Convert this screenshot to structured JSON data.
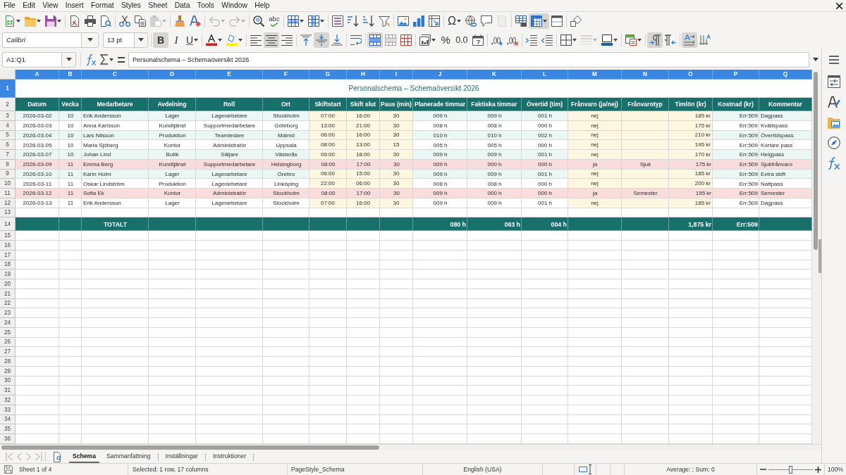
{
  "menu_bar": [
    "File",
    "Edit",
    "View",
    "Insert",
    "Format",
    "Styles",
    "Sheet",
    "Data",
    "Tools",
    "Window",
    "Help"
  ],
  "standard_toolbar": [
    [
      {
        "kind": "new",
        "pressed": false,
        "disabled": false
      },
      {
        "kind": "open",
        "pressed": false,
        "disabled": false
      },
      {
        "kind": "save",
        "pressed": false,
        "disabled": false
      }
    ],
    [
      {
        "kind": "pdf",
        "pressed": false,
        "disabled": false
      },
      {
        "kind": "print",
        "pressed": false,
        "disabled": false
      },
      {
        "kind": "preview",
        "pressed": false,
        "disabled": false
      }
    ],
    [
      {
        "kind": "cut",
        "pressed": false,
        "disabled": false
      },
      {
        "kind": "copy",
        "pressed": false,
        "disabled": false
      },
      {
        "kind": "paste",
        "pressed": false,
        "disabled": true
      }
    ],
    [
      {
        "kind": "clone",
        "pressed": false,
        "disabled": false
      },
      {
        "kind": "clear",
        "pressed": false,
        "disabled": false
      }
    ],
    [
      {
        "kind": "undo",
        "pressed": false,
        "disabled": true
      },
      {
        "kind": "redo",
        "pressed": false,
        "disabled": true
      }
    ],
    [
      {
        "kind": "find",
        "pressed": false,
        "disabled": false
      },
      {
        "kind": "spelling",
        "label": "abc",
        "pressed": false,
        "disabled": false
      }
    ],
    [
      {
        "kind": "row",
        "pressed": false,
        "disabled": false
      },
      {
        "kind": "column",
        "pressed": false,
        "disabled": false
      }
    ],
    [
      {
        "kind": "sort",
        "pressed": false,
        "disabled": false
      },
      {
        "kind": "ascending",
        "pressed": false,
        "disabled": false
      },
      {
        "kind": "descending",
        "pressed": false,
        "disabled": false
      },
      {
        "kind": "filter",
        "pressed": false,
        "disabled": false
      }
    ],
    [
      {
        "kind": "image",
        "pressed": false,
        "disabled": false
      },
      {
        "kind": "chart",
        "pressed": false,
        "disabled": false
      },
      {
        "kind": "pivot",
        "pressed": false,
        "disabled": false
      }
    ],
    [
      {
        "kind": "special",
        "label": "Ω",
        "pressed": false,
        "disabled": false
      },
      {
        "kind": "hyperlink",
        "pressed": false,
        "disabled": false
      },
      {
        "kind": "comment",
        "pressed": false,
        "disabled": false
      },
      {
        "kind": "headerfooter",
        "pressed": false,
        "disabled": true
      }
    ],
    [
      {
        "kind": "printarea",
        "pressed": false,
        "disabled": false
      },
      {
        "kind": "freeze",
        "pressed": true,
        "disabled": false
      },
      {
        "kind": "split",
        "pressed": false,
        "disabled": false
      }
    ],
    [
      {
        "kind": "draw",
        "pressed": false,
        "disabled": false
      }
    ]
  ],
  "formatting_toolbar": {
    "font_name": "Calibri",
    "font_size": "13 pt",
    "groups": [
      [
        {
          "kind": "bold",
          "label": "B",
          "pressed": true,
          "disabled": false
        },
        {
          "kind": "italic",
          "label": "I",
          "pressed": false,
          "disabled": false
        },
        {
          "kind": "underline",
          "label": "U",
          "pressed": false,
          "disabled": false
        }
      ],
      [
        {
          "kind": "fontcolor",
          "pressed": false,
          "disabled": false
        },
        {
          "kind": "highlight",
          "pressed": false,
          "disabled": false
        }
      ],
      [
        {
          "kind": "alignleft",
          "pressed": false,
          "disabled": false
        },
        {
          "kind": "aligncenter",
          "pressed": true,
          "disabled": false
        },
        {
          "kind": "alignright",
          "pressed": false,
          "disabled": false
        }
      ],
      [
        {
          "kind": "aligntop",
          "pressed": false,
          "disabled": false
        },
        {
          "kind": "alignmiddle",
          "pressed": true,
          "disabled": false
        },
        {
          "kind": "alignbottom",
          "pressed": false,
          "disabled": false
        }
      ],
      [
        {
          "kind": "wrap",
          "pressed": false,
          "disabled": false
        }
      ],
      [
        {
          "kind": "mergecenter",
          "pressed": true,
          "disabled": false
        },
        {
          "kind": "merge",
          "pressed": false,
          "disabled": false
        },
        {
          "kind": "unmerge",
          "pressed": false,
          "disabled": false
        }
      ],
      [
        {
          "kind": "currency",
          "pressed": false,
          "disabled": false
        },
        {
          "kind": "percent",
          "label": "%",
          "pressed": false,
          "disabled": false
        },
        {
          "kind": "number",
          "label": "0.0",
          "pressed": false,
          "disabled": false
        },
        {
          "kind": "date",
          "pressed": false,
          "disabled": false
        }
      ],
      [
        {
          "kind": "adddecimal",
          "pressed": false,
          "disabled": false
        },
        {
          "kind": "deletedecimal",
          "pressed": false,
          "disabled": false
        }
      ],
      [
        {
          "kind": "indent",
          "pressed": false,
          "disabled": false
        },
        {
          "kind": "outdent",
          "pressed": false,
          "disabled": false
        }
      ],
      [
        {
          "kind": "borders",
          "pressed": false,
          "disabled": false
        },
        {
          "kind": "borderstyle",
          "pressed": false,
          "disabled": true
        },
        {
          "kind": "bordercolor",
          "pressed": false,
          "disabled": false
        }
      ],
      [
        {
          "kind": "conditional",
          "pressed": false,
          "disabled": false
        }
      ],
      [
        {
          "kind": "ltr",
          "pressed": true,
          "disabled": false
        },
        {
          "kind": "rtl",
          "pressed": false,
          "disabled": false
        }
      ],
      [
        {
          "kind": "textltr",
          "pressed": true,
          "disabled": false
        },
        {
          "kind": "texttb",
          "pressed": false,
          "disabled": false
        }
      ]
    ]
  },
  "formula_bar": {
    "name_box": "A1:Q1",
    "formula": "Personalschema – Schemaöversikt 2026"
  },
  "sheet": {
    "columns": [
      {
        "label": "A",
        "selected": true
      },
      {
        "label": "B",
        "selected": true
      },
      {
        "label": "C",
        "selected": true
      },
      {
        "label": "D",
        "selected": true
      },
      {
        "label": "E",
        "selected": true
      },
      {
        "label": "F",
        "selected": true
      },
      {
        "label": "G",
        "selected": true
      },
      {
        "label": "H",
        "selected": true
      },
      {
        "label": "I",
        "selected": true
      },
      {
        "label": "J",
        "selected": true
      },
      {
        "label": "K",
        "selected": true
      },
      {
        "label": "L",
        "selected": true
      },
      {
        "label": "M",
        "selected": true
      },
      {
        "label": "N",
        "selected": true
      },
      {
        "label": "O",
        "selected": true
      },
      {
        "label": "P",
        "selected": true
      },
      {
        "label": "Q",
        "selected": true
      }
    ],
    "rows": [
      {
        "number": "1",
        "selected": true,
        "kind": "title",
        "title": "Personalschema – Schemaöversikt 2026"
      },
      {
        "number": "2",
        "selected": false,
        "kind": "header",
        "headings": [
          "Datum",
          "Vecka",
          "Medarbetare",
          "Avdelning",
          "Roll",
          "Ort",
          "Skiftstart",
          "Skift slut",
          "Paus (min)",
          "Planerade timmar",
          "Faktiska timmar",
          "Övertid (tim)",
          "Frånvaro (ja/nej)",
          "Frånvarotyp",
          "Timlön (kr)",
          "Kostnad (kr)",
          "Kommentar"
        ]
      },
      {
        "number": "3",
        "selected": false,
        "kind": "data",
        "color": "#eaf7f5",
        "highlighted": false,
        "date": "2026-03-02",
        "week": "10",
        "employee": "Erik Andersson",
        "department": "Lager",
        "role": "Lagerarbetare",
        "city": "Stockholm",
        "shift_start": "07:00",
        "shift_end": "16:00",
        "break_min": "30",
        "planned_hours": "009 h",
        "actual_hours": "009 h",
        "overtime": "001 h",
        "absence": "nej",
        "hourly_wage": "185 kr",
        "cost": "Err:509",
        "comment": "Dagpass"
      },
      {
        "number": "4",
        "selected": false,
        "kind": "data",
        "color": "#ffffff",
        "highlighted": false,
        "date": "2026-03-03",
        "week": "10",
        "employee": "Anna Karlsson",
        "department": "Kundtjänst",
        "role": "Supportmedarbetare",
        "city": "Göteborg",
        "shift_start": "13:00",
        "shift_end": "21:00",
        "break_min": "30",
        "planned_hours": "008 h",
        "actual_hours": "008 h",
        "overtime": "000 h",
        "absence": "nej",
        "hourly_wage": "175 kr",
        "cost": "Err:509",
        "comment": "Kvällspass"
      },
      {
        "number": "5",
        "selected": false,
        "kind": "data",
        "color": "#eaf7f5",
        "highlighted": false,
        "date": "2026-03-04",
        "week": "10",
        "employee": "Lars Nilsson",
        "department": "Produktion",
        "role": "Teamledare",
        "city": "Malmö",
        "shift_start": "06:00",
        "shift_end": "16:00",
        "break_min": "30",
        "planned_hours": "010 h",
        "actual_hours": "010 h",
        "overtime": "002 h",
        "absence": "nej",
        "hourly_wage": "210 kr",
        "cost": "Err:509",
        "comment": "Övertidspass"
      },
      {
        "number": "6",
        "selected": false,
        "kind": "data",
        "color": "#ffffff",
        "highlighted": false,
        "date": "2026-03-05",
        "week": "10",
        "employee": "Maria Sjöberg",
        "department": "Kontor",
        "role": "Administratör",
        "city": "Uppsala",
        "shift_start": "08:00",
        "shift_end": "13:00",
        "break_min": "15",
        "planned_hours": "005 h",
        "actual_hours": "005 h",
        "overtime": "000 h",
        "absence": "nej",
        "hourly_wage": "195 kr",
        "cost": "Err:509",
        "comment": "Kortare pass"
      },
      {
        "number": "7",
        "selected": false,
        "kind": "data",
        "color": "#eaf7f5",
        "highlighted": false,
        "date": "2026-03-07",
        "week": "10",
        "employee": "Johan Lind",
        "department": "Butik",
        "role": "Säljare",
        "city": "Västerås",
        "shift_start": "09:00",
        "shift_end": "18:00",
        "break_min": "30",
        "planned_hours": "009 h",
        "actual_hours": "009 h",
        "overtime": "001 h",
        "absence": "nej",
        "hourly_wage": "170 kr",
        "cost": "Err:509",
        "comment": "Helgpass"
      },
      {
        "number": "8",
        "selected": false,
        "kind": "data",
        "color": "#f9dcdc",
        "highlighted": true,
        "date": "2026-03-09",
        "week": "11",
        "employee": "Emma Berg",
        "department": "Kundtjänst",
        "role": "Supportmedarbetare",
        "city": "Helsingborg",
        "shift_start": "08:00",
        "shift_end": "17:00",
        "break_min": "30",
        "planned_hours": "009 h",
        "actual_hours": "000 h",
        "overtime": "000 h",
        "absence": "ja",
        "absence_type": "Sjuk",
        "hourly_wage": "175 kr",
        "cost": "Err:509",
        "comment": "Sjukfrånvaro"
      },
      {
        "number": "9",
        "selected": false,
        "kind": "data",
        "color": "#eaf7f5",
        "highlighted": false,
        "date": "2026-03-10",
        "week": "11",
        "employee": "Karin Holm",
        "department": "Lager",
        "role": "Lagerarbetare",
        "city": "Örebro",
        "shift_start": "06:00",
        "shift_end": "15:00",
        "break_min": "30",
        "planned_hours": "009 h",
        "actual_hours": "009 h",
        "overtime": "001 h",
        "absence": "nej",
        "hourly_wage": "185 kr",
        "cost": "Err:509",
        "comment": "Extra skift"
      },
      {
        "number": "10",
        "selected": false,
        "kind": "data",
        "color": "#ffffff",
        "highlighted": false,
        "date": "2026-03-11",
        "week": "11",
        "employee": "Oskar Lindström",
        "department": "Produktion",
        "role": "Lagerarbetare",
        "city": "Linköping",
        "shift_start": "22:00",
        "shift_end": "06:00",
        "break_min": "30",
        "planned_hours": "008 h",
        "actual_hours": "008 h",
        "overtime": "000 h",
        "absence": "nej",
        "hourly_wage": "200 kr",
        "cost": "Err:509",
        "comment": "Nattpass"
      },
      {
        "number": "11",
        "selected": false,
        "kind": "data",
        "color": "#f9dcdc",
        "highlighted": true,
        "date": "2026-03-12",
        "week": "11",
        "employee": "Sofia Ek",
        "department": "Kontor",
        "role": "Administratör",
        "city": "Stockholm",
        "shift_start": "08:00",
        "shift_end": "17:00",
        "break_min": "30",
        "planned_hours": "009 h",
        "actual_hours": "000 h",
        "overtime": "000 h",
        "absence": "ja",
        "absence_type": "Semester",
        "hourly_wage": "195 kr",
        "cost": "Err:509",
        "comment": "Semester"
      },
      {
        "number": "12",
        "selected": false,
        "kind": "data",
        "color": "#ffffff",
        "highlighted": false,
        "date": "2026-03-13",
        "week": "11",
        "employee": "Erik Andersson",
        "department": "Lager",
        "role": "Lagerarbetare",
        "city": "Stockholm",
        "shift_start": "07:00",
        "shift_end": "16:00",
        "break_min": "30",
        "planned_hours": "009 h",
        "actual_hours": "009 h",
        "overtime": "001 h",
        "absence": "nej",
        "hourly_wage": "185 kr",
        "cost": "Err:509",
        "comment": "Dagpass"
      },
      {
        "number": "13",
        "selected": false,
        "kind": "blank"
      },
      {
        "number": "14",
        "selected": false,
        "kind": "total",
        "label": "TOTALT",
        "planned_hours": "080 h",
        "actual_hours": "063 h",
        "overtime": "004 h",
        "hourly_wage": "1,875 kr",
        "cost": "Err:509"
      },
      {
        "number": "15",
        "selected": false,
        "kind": "blank"
      },
      {
        "number": "16",
        "selected": false,
        "kind": "blank"
      },
      {
        "number": "17",
        "selected": false,
        "kind": "blank"
      },
      {
        "number": "18",
        "selected": false,
        "kind": "blank"
      },
      {
        "number": "19",
        "selected": false,
        "kind": "blank"
      },
      {
        "number": "20",
        "selected": false,
        "kind": "blank"
      },
      {
        "number": "21",
        "selected": false,
        "kind": "blank"
      },
      {
        "number": "22",
        "selected": false,
        "kind": "blank"
      },
      {
        "number": "23",
        "selected": false,
        "kind": "blank"
      },
      {
        "number": "24",
        "selected": false,
        "kind": "blank"
      },
      {
        "number": "25",
        "selected": false,
        "kind": "blank"
      },
      {
        "number": "26",
        "selected": false,
        "kind": "blank"
      },
      {
        "number": "27",
        "selected": false,
        "kind": "blank"
      },
      {
        "number": "28",
        "selected": false,
        "kind": "blank"
      },
      {
        "number": "29",
        "selected": false,
        "kind": "blank"
      },
      {
        "number": "30",
        "selected": false,
        "kind": "blank"
      },
      {
        "number": "31",
        "selected": false,
        "kind": "blank"
      },
      {
        "number": "32",
        "selected": false,
        "kind": "blank"
      },
      {
        "number": "33",
        "selected": false,
        "kind": "blank"
      },
      {
        "number": "34",
        "selected": false,
        "kind": "blank"
      },
      {
        "number": "35",
        "selected": false,
        "kind": "blank"
      },
      {
        "number": "36",
        "selected": false,
        "kind": "blank"
      }
    ]
  },
  "sheet_tabs": [
    {
      "label": "Schema",
      "selected": true
    },
    {
      "label": "Sammanfattning",
      "selected": false
    },
    {
      "label": "Inställningar",
      "selected": false
    },
    {
      "label": "Instruktioner",
      "selected": false
    }
  ],
  "status_bar": {
    "sheet": "Sheet 1 of 4",
    "selection": "Selected: 1 row, 17 columns",
    "page_style": "PageStyle_Schema",
    "language": "English (USA)",
    "summary": "Average: ; Sum: 0",
    "zoom": {
      "level": 0.5,
      "reading": "100%"
    }
  }
}
